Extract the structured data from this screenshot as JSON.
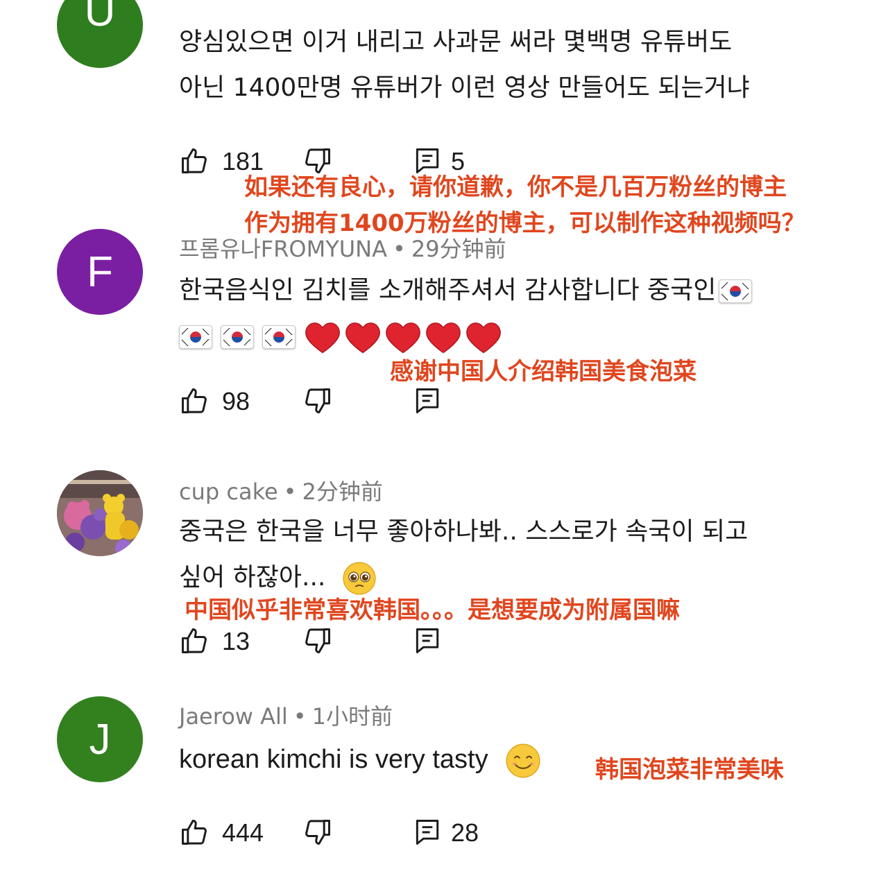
{
  "comments": [
    {
      "avatar_letter": "U",
      "avatar_color": "#2e7d1e",
      "author": "",
      "time": "",
      "lines": [
        "양심있으면 이거 내리고 사과문 써라 몇백명 유튜버도",
        "아닌 1400만명 유튜버가 이런 영상 만들어도 되는거냐"
      ],
      "translation": [
        "如果还有良心，请你道歉，你不是几百万粉丝的博主",
        "作为拥有1400万粉丝的博主，可以制作这种视频吗？"
      ],
      "likes": "181",
      "replies": "5"
    },
    {
      "avatar_letter": "F",
      "avatar_color": "#7b1fa2",
      "author": "프롬유나FROMYUNA",
      "time": "29分钟前",
      "lines": [
        "한국음식인 김치를 소개해주셔서 감사합니다 중국인"
      ],
      "translation": [
        "感谢中国人介绍韩国美食泡菜"
      ],
      "likes": "98",
      "replies": ""
    },
    {
      "avatar_letter": "",
      "avatar_color": "#9c7a6e",
      "author": "cup cake",
      "time": "2分钟前",
      "lines": [
        "중국은 한국을 너무 좋아하나봐.. 스스로가 속국이 되고",
        "싶어 하잖아..."
      ],
      "translation": [
        "中国似乎非常喜欢韩国。。。是想要成为附属国嘛"
      ],
      "likes": "13",
      "replies": ""
    },
    {
      "avatar_letter": "J",
      "avatar_color": "#33801f",
      "author": "Jaerow All",
      "time": "1小时前",
      "lines": [
        "korean kimchi is very tasty"
      ],
      "translation": [
        "韩国泡菜非常美味"
      ],
      "likes": "444",
      "replies": "28"
    }
  ],
  "colors": {
    "translation": "#e0461e",
    "meta": "#7a7a7a",
    "heart": "#e0242f"
  },
  "icons": [
    "like-icon",
    "dislike-icon",
    "reply-icon",
    "korean-flag-icon",
    "red-heart-icon",
    "pleading-face-icon",
    "smiling-face-icon"
  ]
}
